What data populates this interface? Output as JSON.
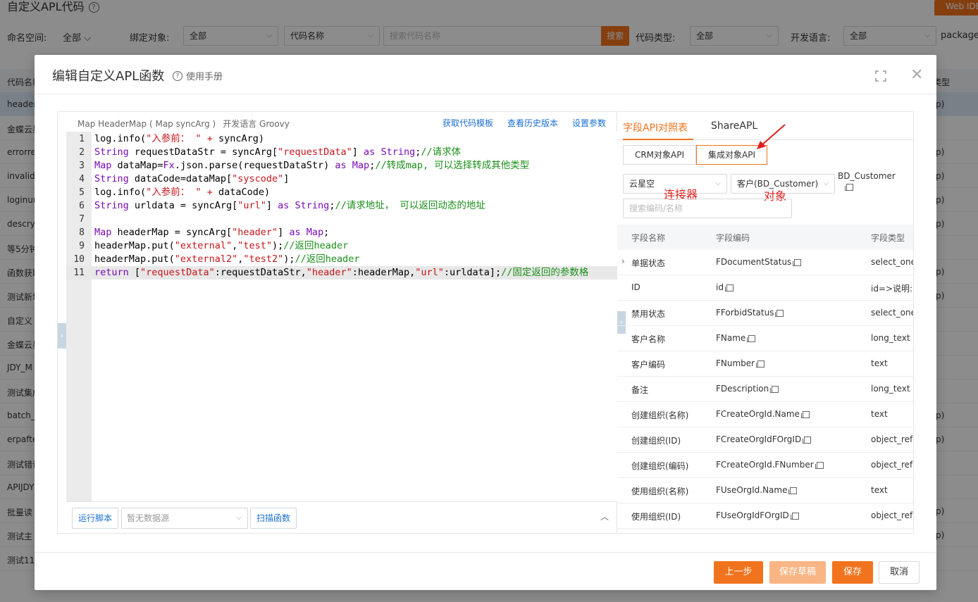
{
  "background": {
    "title": "自定义APL代码",
    "web_ide": "Web IDE",
    "filters": {
      "namespace_label": "命名空间:",
      "namespace_value": "全部",
      "bind_object_label": "绑定对象:",
      "bind_object_value": "全部",
      "code_name_value": "代码名称",
      "search_placeholder": "搜索代码名称",
      "search_button": "搜索",
      "code_type_label": "代码类型:",
      "code_type_value": "全部",
      "dev_lang_label": "开发语言:",
      "dev_lang_value": "全部",
      "package_label": "package"
    },
    "table_header": {
      "name_col": "代码名称",
      "right_col": "类型"
    },
    "rows": [
      {
        "name": "header",
        "right": "p)"
      },
      {
        "name": "金蝶云星",
        "right": ""
      },
      {
        "name": "errorrea",
        "right": "p)"
      },
      {
        "name": "invalid",
        "right": "p)"
      },
      {
        "name": "loginurl",
        "right": "p)"
      },
      {
        "name": "descryD",
        "right": "p)"
      },
      {
        "name": "等5分钟",
        "right": ""
      },
      {
        "name": "函数获取",
        "right": "p)"
      },
      {
        "name": "测试新增",
        "right": "p)"
      },
      {
        "name": "自定义",
        "right": ""
      },
      {
        "name": "金蝶云星",
        "right": ""
      },
      {
        "name": "JDY_M",
        "right": ""
      },
      {
        "name": "测试集成",
        "right": ""
      },
      {
        "name": "batch_r",
        "right": "p)"
      },
      {
        "name": "erpafter",
        "right": "p)"
      },
      {
        "name": "测试错误",
        "right": ""
      },
      {
        "name": "APIJDY",
        "right": ""
      },
      {
        "name": "批量读",
        "right": "p)"
      },
      {
        "name": "测试主",
        "right": "p)"
      },
      {
        "name": "测试11",
        "right": ""
      }
    ]
  },
  "modal": {
    "title": "编辑自定义APL函数",
    "help": "使用手册",
    "signature": "Map HeaderMap ( Map syncArg )",
    "language": "开发语言 Groovy",
    "links": [
      "获取代码模板",
      "查看历史版本",
      "设置参数"
    ],
    "code_lines": [
      "log.info(\"入参前： \" + syncArg)",
      "String requestDataStr = syncArg[\"requestData\"] as String;//请求体",
      "Map dataMap=Fx.json.parse(requestDataStr) as Map;//转成map, 可以选择转成其他类型",
      "String dataCode=dataMap[\"syscode\"]",
      "log.info(\"入参前： \" + dataCode)",
      "String urldata = syncArg[\"url\"] as String;//请求地址， 可以返回动态的地址",
      "",
      "Map headerMap = syncArg[\"header\"] as Map;",
      "headerMap.put(\"external\",\"test\");//返回header",
      "headerMap.put(\"external2\",\"test2\");//返回header",
      "return [\"requestData\":requestDataStr,\"header\":headerMap,\"url\":urldata];//固定返回的参数格"
    ],
    "bottom": {
      "run_script": "运行脚本",
      "datasource_placeholder": "暂无数据源",
      "scan_function": "扫描函数"
    },
    "api_panel": {
      "tabs": [
        "字段API对照表",
        "ShareAPL"
      ],
      "segments": [
        "CRM对象API",
        "集成对象API"
      ],
      "connector_value": "云星空",
      "object_value": "客户(BD_Customer)",
      "object_code": "BD_Customer",
      "annotation_connector": "连接器",
      "annotation_object": "对象",
      "search_placeholder": "搜索编码/名称",
      "columns": [
        "字段名称",
        "字段编码",
        "字段类型"
      ],
      "rows": [
        {
          "name": "单据状态",
          "code": "FDocumentStatus",
          "type": "select_one",
          "expand": true
        },
        {
          "name": "ID",
          "code": "id",
          "type": "id=>说明:",
          "expand": false
        },
        {
          "name": "禁用状态",
          "code": "FForbidStatus",
          "type": "select_one",
          "expand": false
        },
        {
          "name": "客户名称",
          "code": "FName",
          "type": "long_text",
          "expand": false
        },
        {
          "name": "客户编码",
          "code": "FNumber",
          "type": "text",
          "expand": false
        },
        {
          "name": "备注",
          "code": "FDescription",
          "type": "long_text",
          "expand": false
        },
        {
          "name": "创建组织(名称)",
          "code": "FCreateOrgId.Name",
          "type": "text",
          "expand": false
        },
        {
          "name": "创建组织(ID)",
          "code": "FCreateOrgIdFOrgID",
          "type": "object_refe",
          "expand": false
        },
        {
          "name": "创建组织(编码)",
          "code": "FCreateOrgId.FNumber",
          "type": "object_refe",
          "expand": false
        },
        {
          "name": "使用组织(名称)",
          "code": "FUseOrgId.Name",
          "type": "text",
          "expand": false
        },
        {
          "name": "使用组织(ID)",
          "code": "FUseOrgIdFOrgID",
          "type": "object_refe",
          "expand": false
        }
      ]
    },
    "footer": {
      "prev": "上一步",
      "save_draft": "保存草稿",
      "save": "保存",
      "cancel": "取消"
    }
  },
  "colors": {
    "accent": "#f2731d",
    "link": "#1b6fd3",
    "annotation": "#e02020"
  }
}
